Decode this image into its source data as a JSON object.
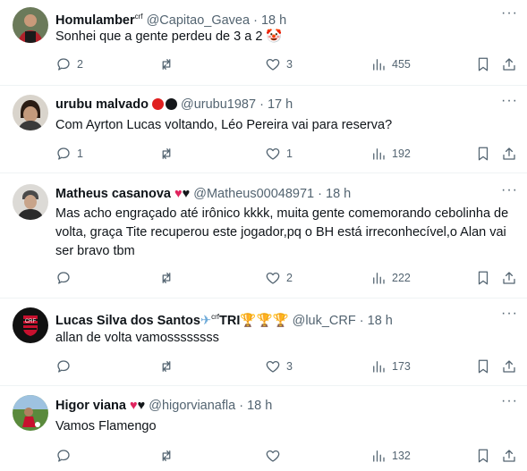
{
  "tweets": [
    {
      "name": "Homulamber",
      "name_suffix": "crf",
      "handle": "@Capitao_Gavea",
      "time": "18 h",
      "text": "Sonhei que a gente perdeu de 3 a 2 🤡",
      "replies": "2",
      "retweets": "",
      "likes": "3",
      "views": "455"
    },
    {
      "name": "urubu malvado",
      "handle": "@urubu1987",
      "time": "17 h",
      "text": "Com Ayrton Lucas voltando, Léo Pereira vai para reserva?",
      "replies": "1",
      "retweets": "",
      "likes": "1",
      "views": "192"
    },
    {
      "name": "Matheus casanova",
      "handle": "@Matheus00048971",
      "time": "18 h",
      "text": "Mas acho engraçado até irônico kkkk, muita gente comemorando cebolinha de volta, graça Tite recuperou este jogador,pq o BH está irreconhecível,o Alan vai ser bravo tbm",
      "replies": "",
      "retweets": "",
      "likes": "2",
      "views": "222"
    },
    {
      "name": "Lucas Silva dos Santos",
      "name_suffix": "crf",
      "name_tri": "TRI",
      "handle": "@luk_CRF",
      "time": "18 h",
      "text": "allan de volta vamossssssss",
      "replies": "",
      "retweets": "",
      "likes": "3",
      "views": "173"
    },
    {
      "name": "Higor viana",
      "handle": "@higorvianafla",
      "time": "18 h",
      "text": "Vamos Flamengo",
      "replies": "",
      "retweets": "",
      "likes": "",
      "views": "132"
    }
  ],
  "separator": "·",
  "more_label": "···",
  "colors": {
    "text": "#0f1419",
    "muted": "#536471",
    "border": "#eff3f4",
    "red": "#e0245e",
    "black": "#14171a"
  },
  "icons": [
    "reply-icon",
    "retweet-icon",
    "like-icon",
    "views-icon",
    "bookmark-icon",
    "share-icon",
    "more-icon",
    "plane-icon",
    "trophy-icon",
    "heart-icon"
  ]
}
